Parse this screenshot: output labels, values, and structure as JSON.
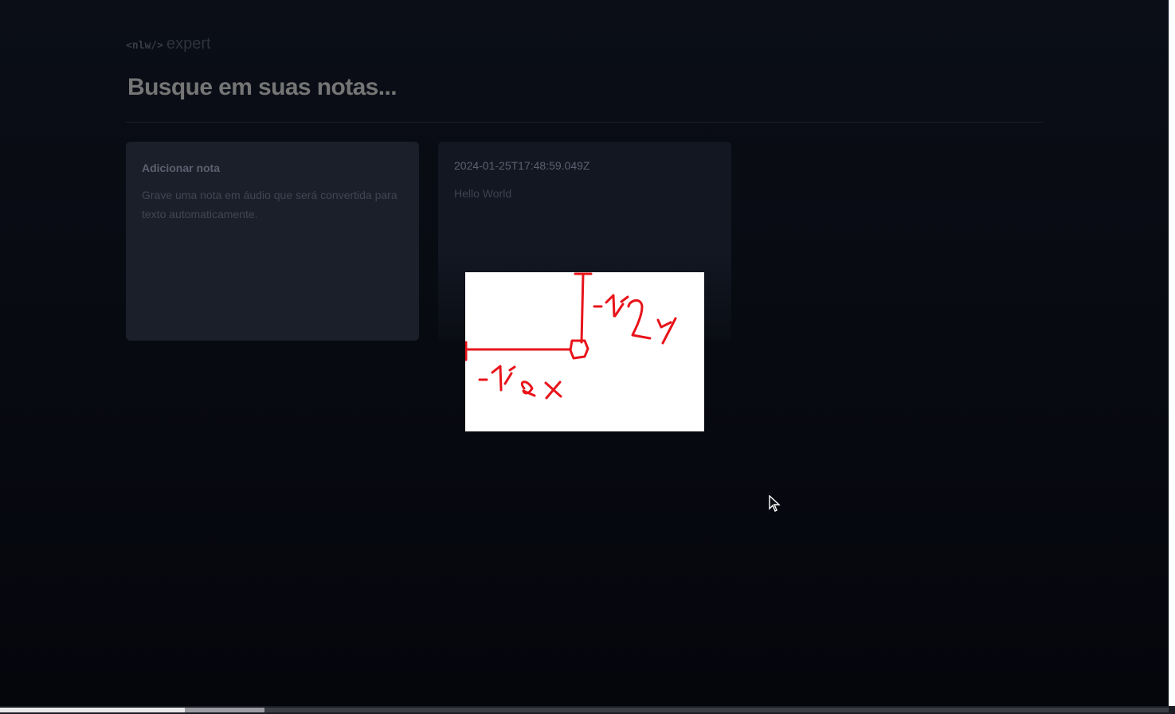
{
  "logo": {
    "left_part": "<nlw/>",
    "right_part": "expert"
  },
  "search": {
    "placeholder": "Busque em suas notas..."
  },
  "cards": {
    "add_note": {
      "title": "Adicionar nota",
      "description": "Grave uma nota em áudio que será convertida para texto automaticamente."
    },
    "note": {
      "date": "2024-01-25T17:48:59.049Z",
      "content": "Hello World"
    }
  },
  "overlay": {
    "label_y": "-1/2y",
    "label_x": "-1/2x",
    "stroke_color": "#e8141b"
  },
  "colors": {
    "background": "#0a0c14",
    "card_add": "#1a1f29",
    "card_note": "#121722"
  }
}
